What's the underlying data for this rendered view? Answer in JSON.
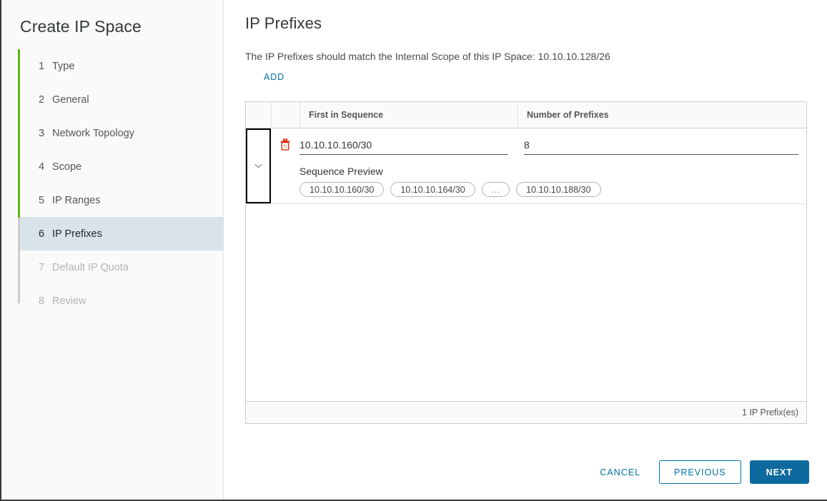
{
  "wizard": {
    "title": "Create IP Space",
    "steps": [
      {
        "num": "1",
        "label": "Type",
        "state": "done"
      },
      {
        "num": "2",
        "label": "General",
        "state": "done"
      },
      {
        "num": "3",
        "label": "Network Topology",
        "state": "done"
      },
      {
        "num": "4",
        "label": "Scope",
        "state": "done"
      },
      {
        "num": "5",
        "label": "IP Ranges",
        "state": "done"
      },
      {
        "num": "6",
        "label": "IP Prefixes",
        "state": "active"
      },
      {
        "num": "7",
        "label": "Default IP Quota",
        "state": "disabled"
      },
      {
        "num": "8",
        "label": "Review",
        "state": "disabled"
      }
    ]
  },
  "page": {
    "title": "IP Prefixes",
    "description": "The IP Prefixes should match the Internal Scope of this IP Space: 10.10.10.128/26",
    "add_label": "ADD"
  },
  "table": {
    "columns": {
      "first_in_sequence": "First in Sequence",
      "number_of_prefixes": "Number of Prefixes"
    },
    "rows": [
      {
        "first_in_sequence": "10.10.10.160/30",
        "first_in_sequence_placeholder": "",
        "number_of_prefixes": "8",
        "number_of_prefixes_placeholder": "",
        "sequence_preview_label": "Sequence Preview",
        "sequence_preview": [
          "10.10.10.160/30",
          "10.10.10.164/30",
          "...",
          "10.10.10.188/30"
        ]
      }
    ],
    "footer_count": "1 IP Prefix(es)"
  },
  "actions": {
    "cancel": "CANCEL",
    "previous": "PREVIOUS",
    "next": "NEXT"
  },
  "colors": {
    "accent_blue": "#0072a3",
    "next_button": "#0e6a9e",
    "progress_green": "#60b515",
    "active_step_bg": "#d9e4ea",
    "delete_icon": "#e12200"
  }
}
